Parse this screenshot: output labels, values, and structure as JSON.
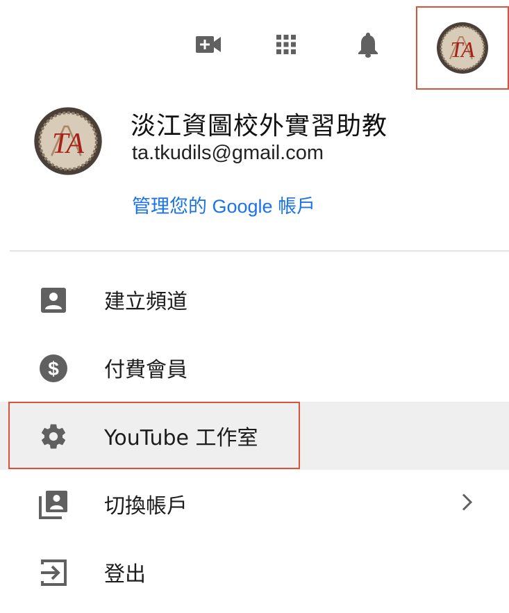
{
  "topbar": {
    "icons": [
      "video-create-icon",
      "apps-grid-icon",
      "notifications-bell-icon"
    ],
    "avatar_text": "TA"
  },
  "account": {
    "name": "淡江資圖校外實習助教",
    "email": "ta.tkudils@gmail.com",
    "manage_link": "管理您的 Google 帳戶",
    "avatar_text": "TA"
  },
  "menu": {
    "items": [
      {
        "label": "建立頻道",
        "icon": "create-channel-icon"
      },
      {
        "label": "付費會員",
        "icon": "paid-membership-icon"
      },
      {
        "label": "YouTube 工作室",
        "icon": "studio-gear-icon"
      },
      {
        "label": "切換帳戶",
        "icon": "switch-account-icon"
      },
      {
        "label": "登出",
        "icon": "sign-out-icon"
      }
    ]
  },
  "colors": {
    "accent_blue": "#1a73e8",
    "highlight_border": "#d9533b",
    "icon_gray": "#606060",
    "active_bg": "#efefef"
  }
}
